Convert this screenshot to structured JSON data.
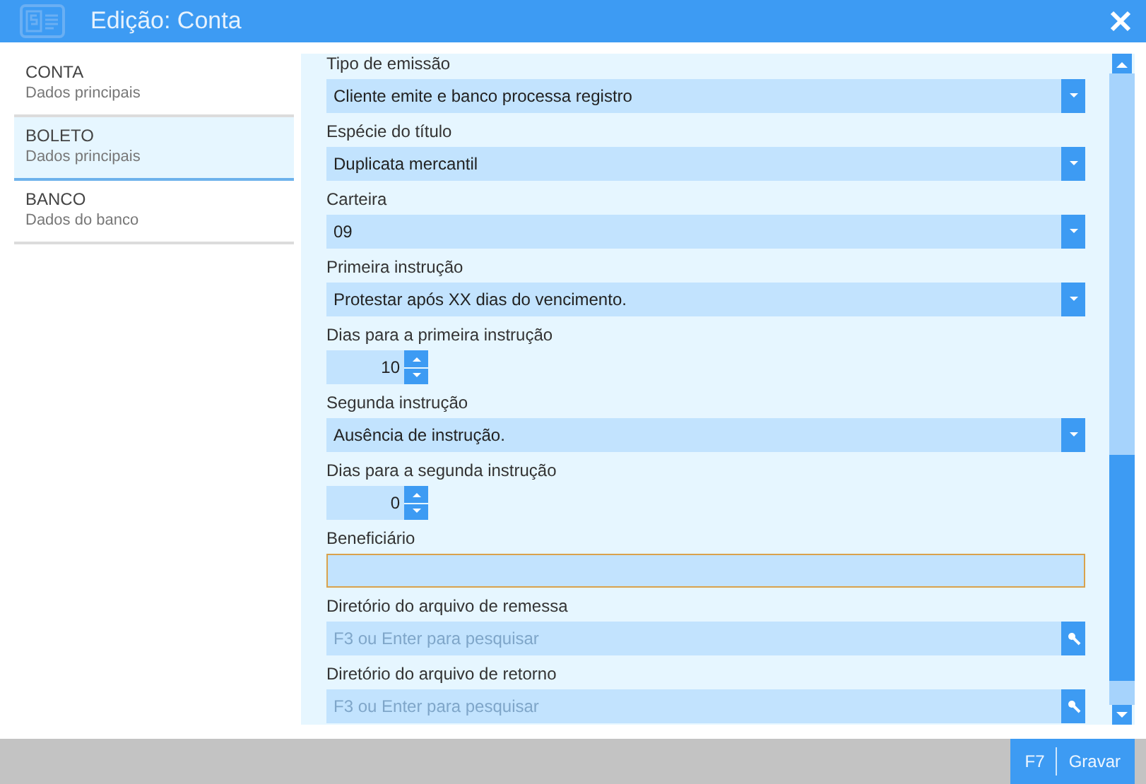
{
  "window": {
    "title": "Edição: Conta"
  },
  "sidebar": {
    "items": [
      {
        "title": "CONTA",
        "subtitle": "Dados principais",
        "selected": false
      },
      {
        "title": "BOLETO",
        "subtitle": "Dados principais",
        "selected": true
      },
      {
        "title": "BANCO",
        "subtitle": "Dados do banco",
        "selected": false
      }
    ]
  },
  "form": {
    "fields": [
      {
        "kind": "select",
        "label": "Tipo de emissão",
        "value": "Cliente emite e banco processa registro"
      },
      {
        "kind": "select",
        "label": "Espécie do título",
        "value": "Duplicata mercantil"
      },
      {
        "kind": "select",
        "label": "Carteira",
        "value": "09"
      },
      {
        "kind": "select",
        "label": "Primeira instrução",
        "value": "Protestar após XX dias do vencimento."
      },
      {
        "kind": "spinner",
        "label": "Dias para a primeira instrução",
        "value": "10"
      },
      {
        "kind": "select",
        "label": "Segunda instrução",
        "value": "Ausência de instrução."
      },
      {
        "kind": "spinner",
        "label": "Dias para a segunda instrução",
        "value": "0"
      },
      {
        "kind": "text",
        "label": "Beneficiário",
        "focused": true
      },
      {
        "kind": "search",
        "label": "Diretório do arquivo de remessa",
        "placeholder": "F3 ou Enter para pesquisar"
      },
      {
        "kind": "search",
        "label": "Diretório do arquivo de retorno",
        "placeholder": "F3 ou Enter para pesquisar"
      }
    ]
  },
  "footer": {
    "buttons": [
      {
        "shortcut": "F7",
        "label": "Gravar"
      }
    ]
  }
}
